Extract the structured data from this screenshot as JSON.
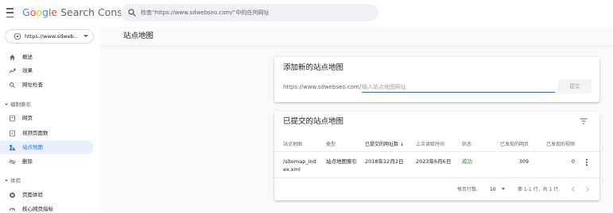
{
  "header": {
    "logo": {
      "google": "Google",
      "product": "Search Console"
    },
    "search_placeholder": "检查“https://www.sdwebseo.com/”中的任何网址"
  },
  "sidebar": {
    "property": "https://www.sdweb...",
    "items": [
      {
        "label": "概述",
        "icon": "home-icon"
      },
      {
        "label": "效果",
        "icon": "trending-up-icon"
      },
      {
        "label": "网址检查",
        "icon": "search-icon"
      }
    ],
    "section_index": {
      "title": "编制索引",
      "items": [
        {
          "label": "网页",
          "icon": "page-icon"
        },
        {
          "label": "视频页面数",
          "icon": "video-page-icon"
        },
        {
          "label": "站点地图",
          "icon": "sitemap-icon",
          "active": true
        },
        {
          "label": "删除",
          "icon": "removal-icon"
        }
      ]
    },
    "section_experience": {
      "title": "体验",
      "items": [
        {
          "label": "页面体验",
          "icon": "page-experience-icon"
        },
        {
          "label": "核心网页指标",
          "icon": "speedometer-icon"
        }
      ]
    }
  },
  "main": {
    "page_title": "站点地图",
    "add_card": {
      "title": "添加新的站点地图",
      "url_prefix": "https://www.sdwebseo.com/",
      "input_value": "",
      "input_placeholder": "输入站点地图网址",
      "submit_label": "提交"
    },
    "submitted_card": {
      "title": "已提交的站点地图",
      "columns": [
        "站点地图",
        "类型",
        "已提交的网址数",
        "上次读取时间",
        "状态",
        "已发现的网页",
        "已发现的视频"
      ],
      "sort_arrow": "↓",
      "rows": [
        {
          "sitemap": "/sitemap_index.xml",
          "type": "站点地图索引",
          "submitted": "2018年12月2日",
          "last_read": "2023年6月6日",
          "status": "成功",
          "pages": "309",
          "videos": "0"
        }
      ],
      "pagination": {
        "rows_per_page_label": "每页行数:",
        "rows_per_page": "10",
        "range": "第 1-1 行，共 1 行"
      }
    }
  },
  "colors": {
    "accent": "#1a73e8",
    "active_bg": "#e8f0fe",
    "success": "#188038",
    "google_blue": "#4285f4",
    "google_red": "#ea4335",
    "google_yellow": "#fbbc05",
    "google_green": "#34a853"
  }
}
